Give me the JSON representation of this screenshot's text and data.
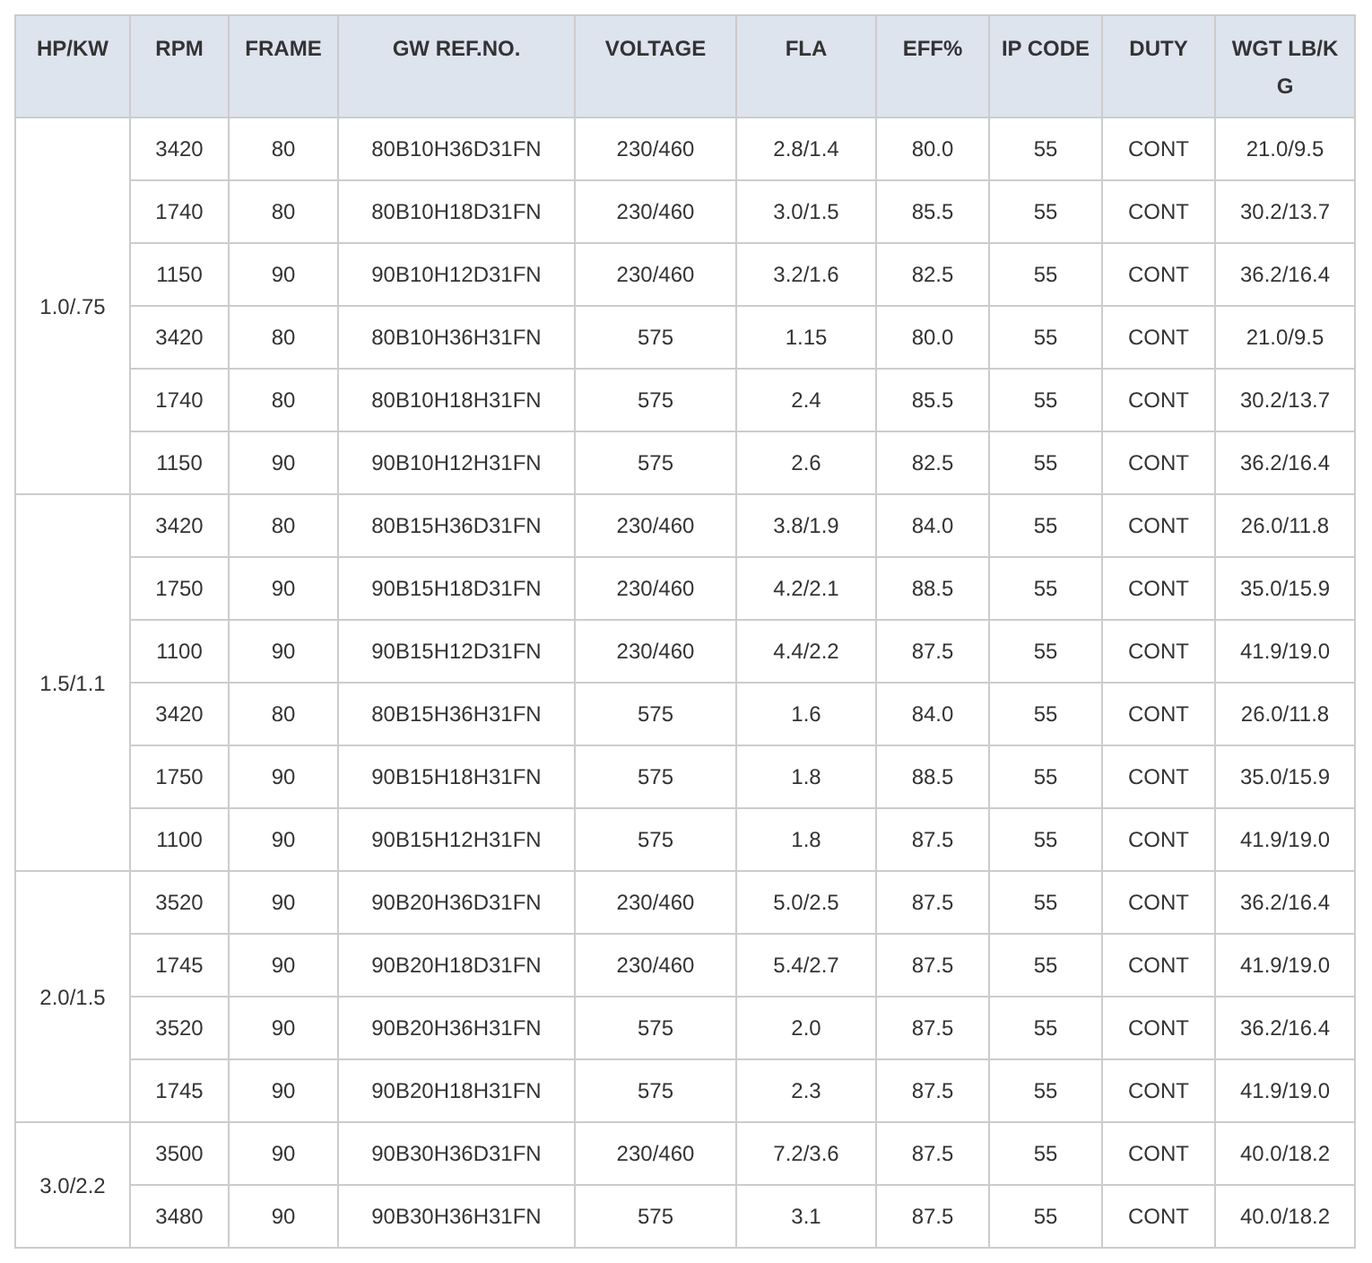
{
  "table": {
    "columns": [
      "HP/KW",
      "RPM",
      "FRAME",
      "GW REF.NO.",
      "VOLTAGE",
      "FLA",
      "EFF%",
      "IP CODE",
      "DUTY",
      "WGT LB/KG"
    ],
    "groups": [
      {
        "hp": "1.0/.75",
        "rows": [
          [
            "3420",
            "80",
            "80B10H36D31FN",
            "230/460",
            "2.8/1.4",
            "80.0",
            "55",
            "CONT",
            "21.0/9.5"
          ],
          [
            "1740",
            "80",
            "80B10H18D31FN",
            "230/460",
            "3.0/1.5",
            "85.5",
            "55",
            "CONT",
            "30.2/13.7"
          ],
          [
            "1150",
            "90",
            "90B10H12D31FN",
            "230/460",
            "3.2/1.6",
            "82.5",
            "55",
            "CONT",
            "36.2/16.4"
          ],
          [
            "3420",
            "80",
            "80B10H36H31FN",
            "575",
            "1.15",
            "80.0",
            "55",
            "CONT",
            "21.0/9.5"
          ],
          [
            "1740",
            "80",
            "80B10H18H31FN",
            "575",
            "2.4",
            "85.5",
            "55",
            "CONT",
            "30.2/13.7"
          ],
          [
            "1150",
            "90",
            "90B10H12H31FN",
            "575",
            "2.6",
            "82.5",
            "55",
            "CONT",
            "36.2/16.4"
          ]
        ]
      },
      {
        "hp": "1.5/1.1",
        "rows": [
          [
            "3420",
            "80",
            "80B15H36D31FN",
            "230/460",
            "3.8/1.9",
            "84.0",
            "55",
            "CONT",
            "26.0/11.8"
          ],
          [
            "1750",
            "90",
            "90B15H18D31FN",
            "230/460",
            "4.2/2.1",
            "88.5",
            "55",
            "CONT",
            "35.0/15.9"
          ],
          [
            "1100",
            "90",
            "90B15H12D31FN",
            "230/460",
            "4.4/2.2",
            "87.5",
            "55",
            "CONT",
            "41.9/19.0"
          ],
          [
            "3420",
            "80",
            "80B15H36H31FN",
            "575",
            "1.6",
            "84.0",
            "55",
            "CONT",
            "26.0/11.8"
          ],
          [
            "1750",
            "90",
            "90B15H18H31FN",
            "575",
            "1.8",
            "88.5",
            "55",
            "CONT",
            "35.0/15.9"
          ],
          [
            "1100",
            "90",
            "90B15H12H31FN",
            "575",
            "1.8",
            "87.5",
            "55",
            "CONT",
            "41.9/19.0"
          ]
        ]
      },
      {
        "hp": "2.0/1.5",
        "rows": [
          [
            "3520",
            "90",
            "90B20H36D31FN",
            "230/460",
            "5.0/2.5",
            "87.5",
            "55",
            "CONT",
            "36.2/16.4"
          ],
          [
            "1745",
            "90",
            "90B20H18D31FN",
            "230/460",
            "5.4/2.7",
            "87.5",
            "55",
            "CONT",
            "41.9/19.0"
          ],
          [
            "3520",
            "90",
            "90B20H36H31FN",
            "575",
            "2.0",
            "87.5",
            "55",
            "CONT",
            "36.2/16.4"
          ],
          [
            "1745",
            "90",
            "90B20H18H31FN",
            "575",
            "2.3",
            "87.5",
            "55",
            "CONT",
            "41.9/19.0"
          ]
        ]
      },
      {
        "hp": "3.0/2.2",
        "rows": [
          [
            "3500",
            "90",
            "90B30H36D31FN",
            "230/460",
            "7.2/3.6",
            "87.5",
            "55",
            "CONT",
            "40.0/18.2"
          ],
          [
            "3480",
            "90",
            "90B30H36H31FN",
            "575",
            "3.1",
            "87.5",
            "55",
            "CONT",
            "40.0/18.2"
          ]
        ]
      }
    ]
  }
}
